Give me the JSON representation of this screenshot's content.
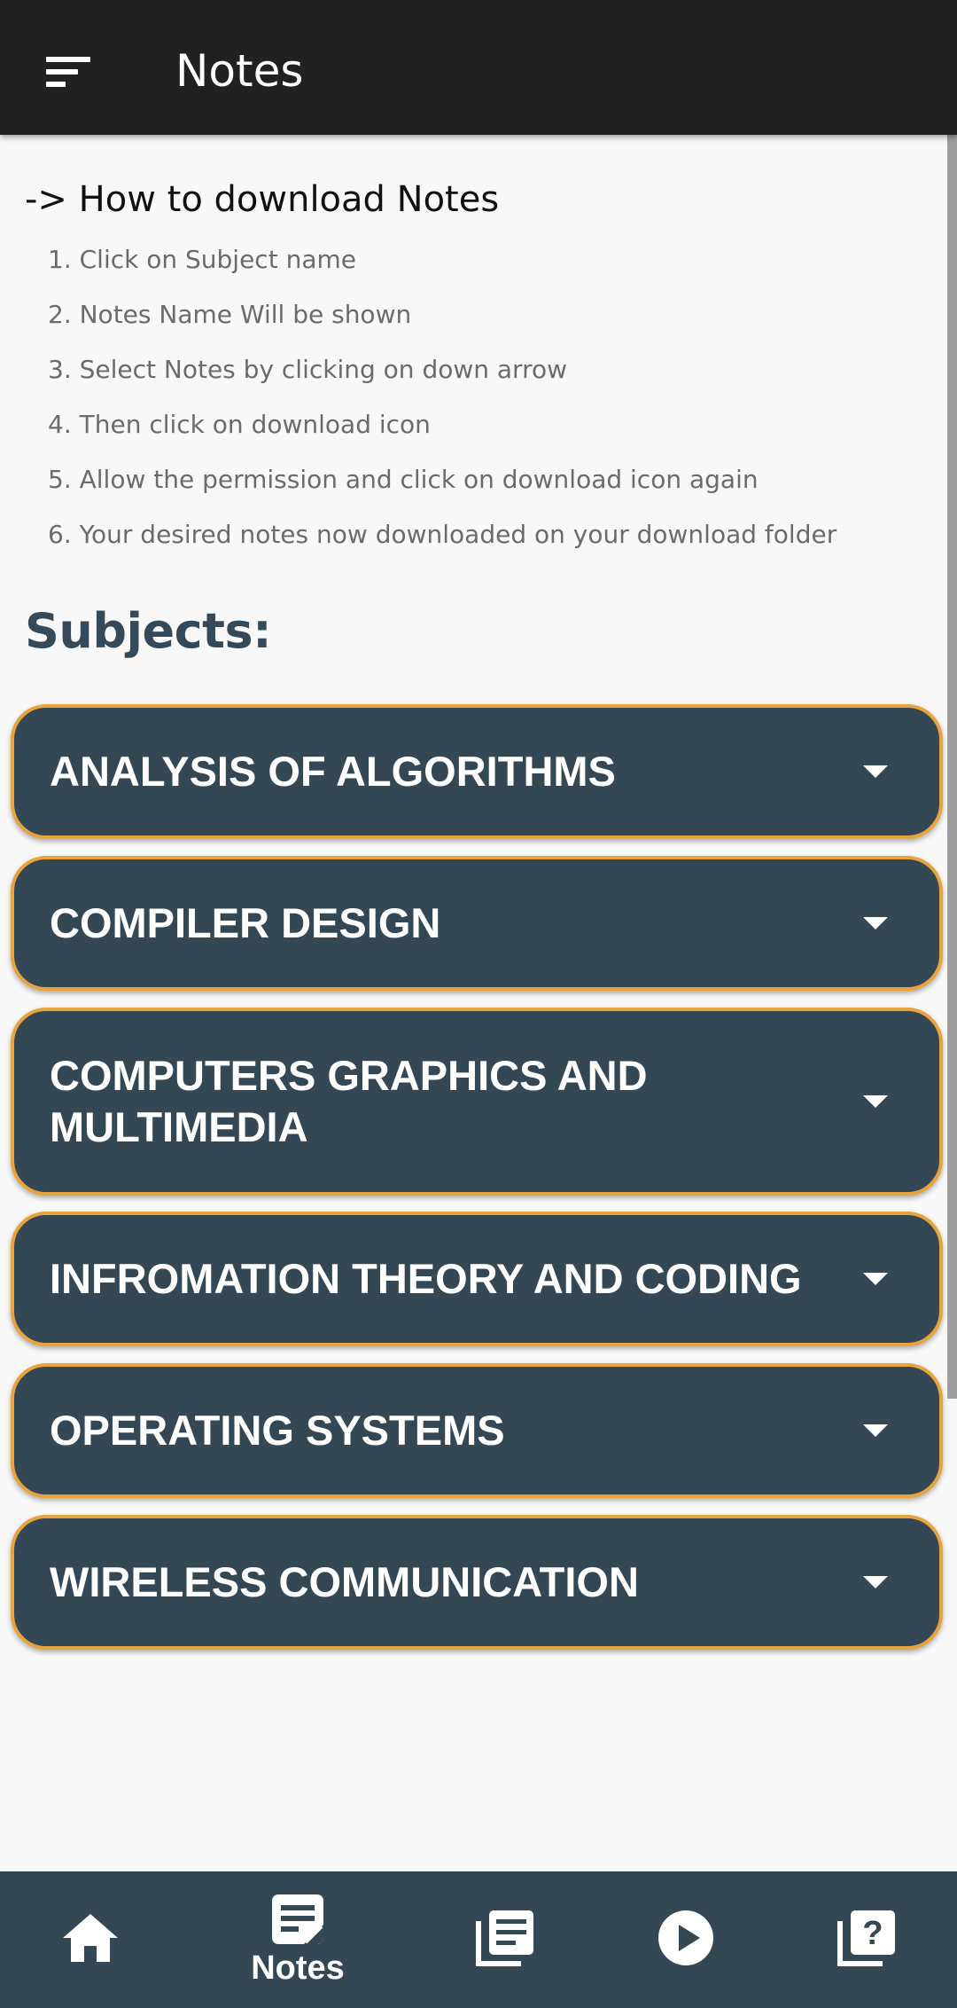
{
  "appbar": {
    "title": "Notes",
    "menu_icon": "sort-menu-icon"
  },
  "instructions": {
    "title": "-> How to download Notes",
    "steps": [
      "1. Click on Subject name",
      "2. Notes Name Will be shown",
      "3. Select Notes by clicking on down arrow",
      "4. Then click on download icon",
      "5. Allow the permission and click on download icon again",
      "6. Your desired notes now downloaded on your download folder"
    ]
  },
  "subjects": {
    "heading": "Subjects:",
    "items": [
      {
        "label": "ANALYSIS OF ALGORITHMS"
      },
      {
        "label": "COMPILER DESIGN"
      },
      {
        "label": "COMPUTERS GRAPHICS AND MULTIMEDIA"
      },
      {
        "label": "INFROMATION THEORY AND CODING"
      },
      {
        "label": "OPERATING SYSTEMS"
      },
      {
        "label": "WIRELESS COMMUNICATION"
      }
    ]
  },
  "bottom_nav": {
    "items": [
      {
        "icon": "home-icon",
        "label": ""
      },
      {
        "icon": "notes-icon",
        "label": "Notes",
        "selected": true
      },
      {
        "icon": "library-books-icon",
        "label": ""
      },
      {
        "icon": "play-circle-icon",
        "label": ""
      },
      {
        "icon": "quiz-icon",
        "label": ""
      }
    ]
  },
  "colors": {
    "appbar": "#212121",
    "background": "#f8f8f8",
    "card": "#344755",
    "card_border": "#e8a33c",
    "heading": "#34495a",
    "bottom_nav": "#344755"
  }
}
